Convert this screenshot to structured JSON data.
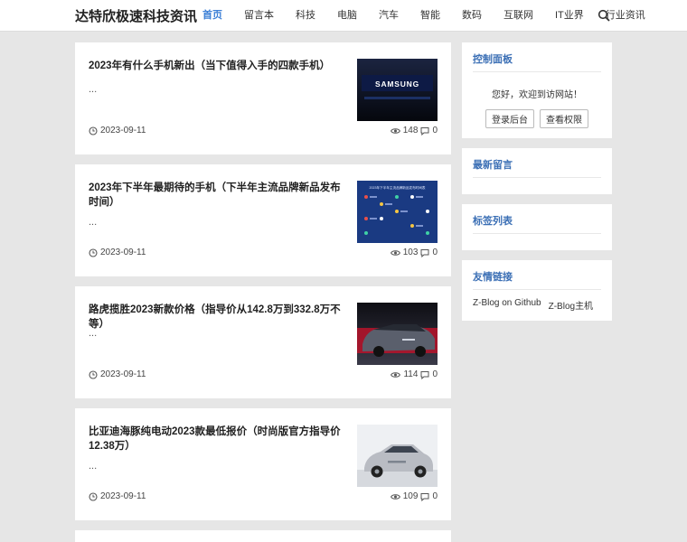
{
  "site_title": "达特欣极速科技资讯",
  "nav": [
    "首页",
    "留言本",
    "科技",
    "电脑",
    "汽车",
    "智能",
    "数码",
    "互联网",
    "IT业界",
    "行业资讯"
  ],
  "posts": [
    {
      "title": "2023年有什么手机新出（当下值得入手的四款手机）",
      "excerpt": "...",
      "date": "2023-09-11",
      "views": "148",
      "comments": "0",
      "thumb_text": "SAMSUNG"
    },
    {
      "title": "2023年下半年最期待的手机（下半年主流品牌新品发布时间）",
      "excerpt": "...",
      "date": "2023-09-11",
      "views": "103",
      "comments": "0",
      "thumb_text": "2023年下半年主流品牌新品发布时间表"
    },
    {
      "title": "路虎揽胜2023新款价格（指导价从142.8万到332.8万不等）",
      "excerpt": "...",
      "date": "2023-09-11",
      "views": "114",
      "comments": "0"
    },
    {
      "title": "比亚迪海豚纯电动2023款最低报价（时尚版官方指导价12.38万）",
      "excerpt": "...",
      "date": "2023-09-11",
      "views": "109",
      "comments": "0"
    }
  ],
  "sidebar": {
    "control": {
      "title": "控制面板",
      "welcome": "您好，欢迎到访网站！",
      "login": "登录后台",
      "perm": "查看权限"
    },
    "latest_comments": {
      "title": "最新留言"
    },
    "tags": {
      "title": "标签列表"
    },
    "links": {
      "title": "友情链接",
      "items": [
        "Z-Blog on Github",
        "Z-Blog主机"
      ]
    }
  },
  "colors": {
    "accent": "#3b7fd6",
    "widget_title": "#3b6fb5",
    "background": "#e6e6e6"
  }
}
